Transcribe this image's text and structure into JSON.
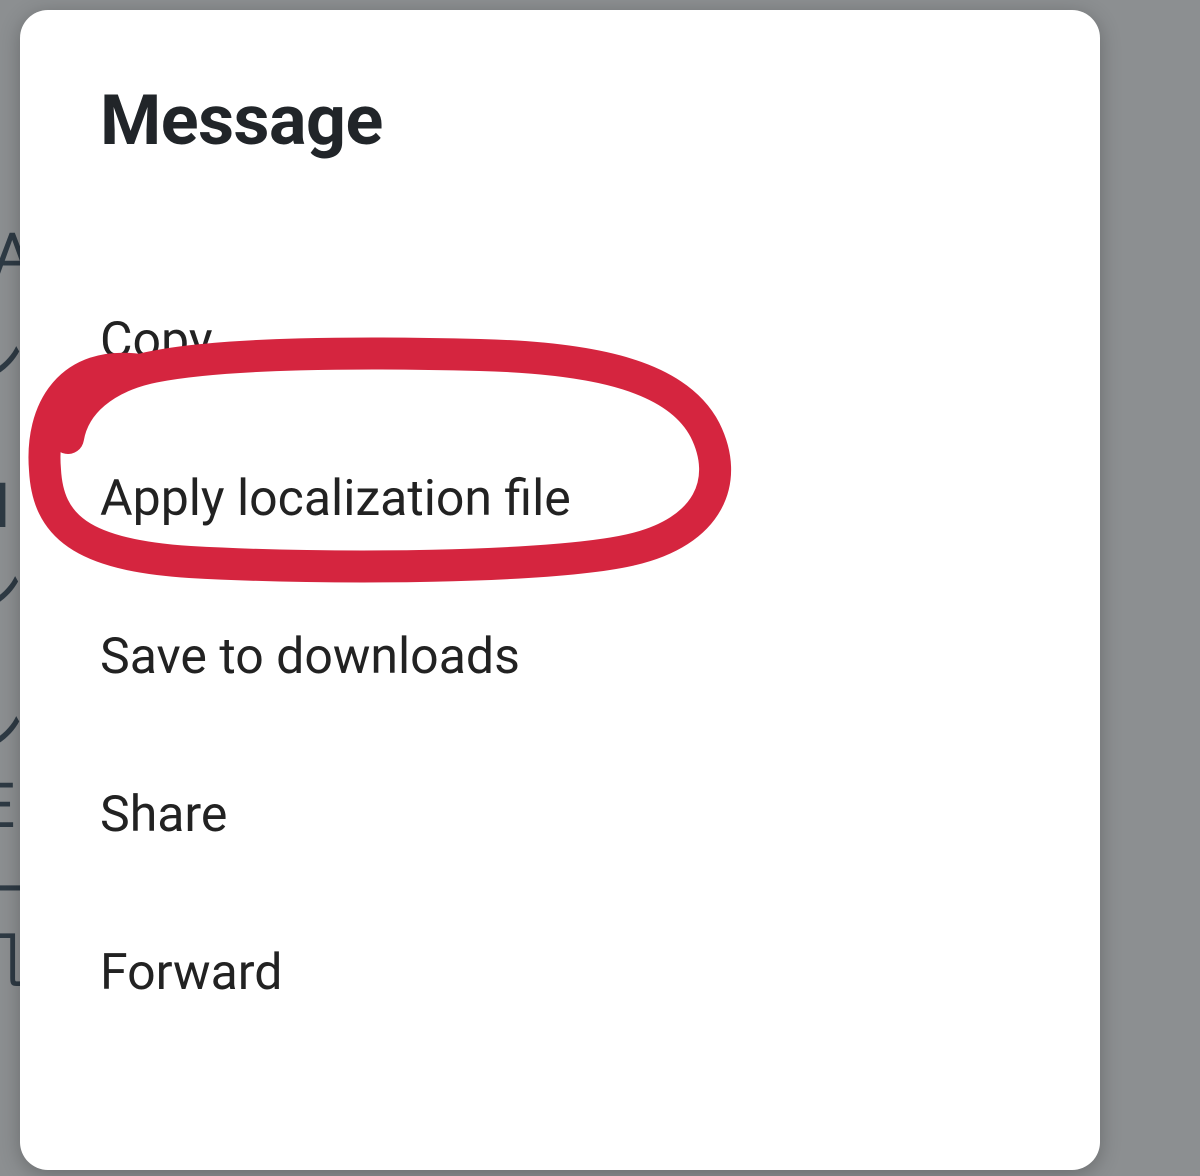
{
  "dialog": {
    "title": "Message",
    "items": [
      {
        "label": "Copy"
      },
      {
        "label": "Apply localization file"
      },
      {
        "label": "Save to downloads"
      },
      {
        "label": "Share"
      },
      {
        "label": "Forward"
      }
    ]
  },
  "annotation": {
    "target_index": 1,
    "color": "#d5253f"
  },
  "background_text_fragments": [
    "A",
    "ン",
    "I",
    "ーン",
    "ン",
    "E",
    "一",
    "几"
  ]
}
